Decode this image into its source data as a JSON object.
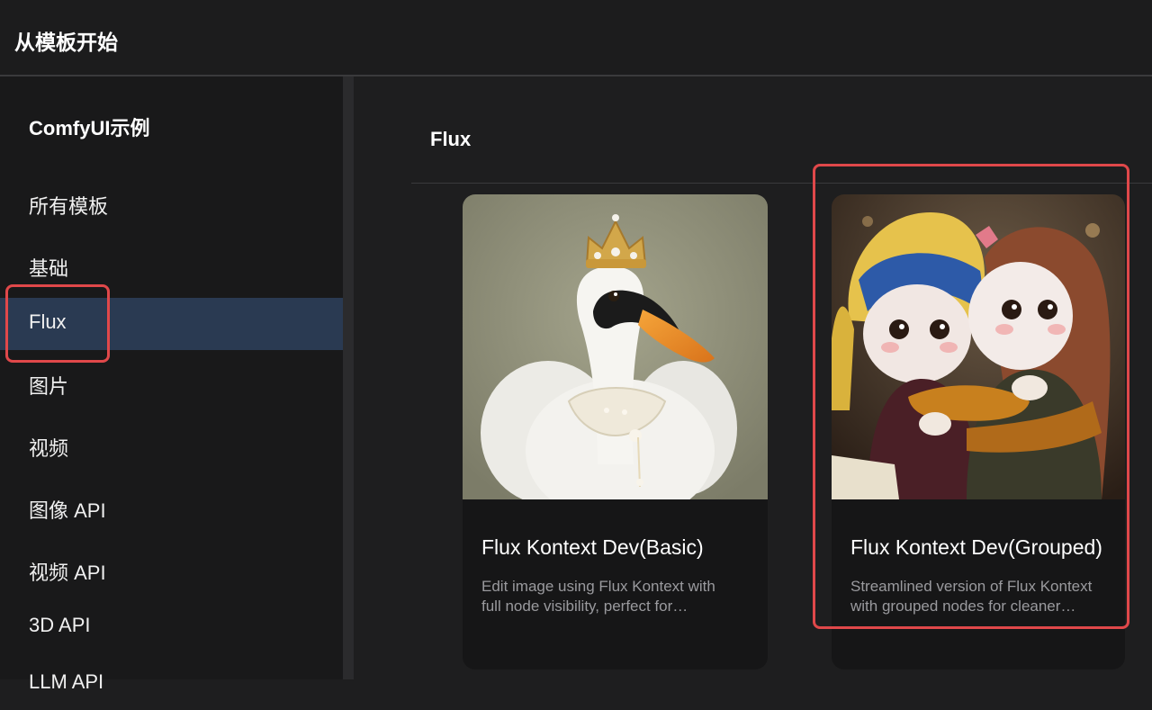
{
  "header": {
    "title": "从模板开始"
  },
  "sidebar": {
    "heading": "ComfyUI示例",
    "items": [
      {
        "label": "所有模板",
        "active": false
      },
      {
        "label": "基础",
        "active": false
      },
      {
        "label": "Flux",
        "active": true
      },
      {
        "label": "图片",
        "active": false
      },
      {
        "label": "视频",
        "active": false
      },
      {
        "label": "图像 API",
        "active": false
      },
      {
        "label": "视频 API",
        "active": false
      },
      {
        "label": "3D API",
        "active": false
      },
      {
        "label": "LLM API",
        "active": false
      }
    ]
  },
  "main": {
    "section_title": "Flux",
    "cards": [
      {
        "title": "Flux Kontext Dev(Basic)",
        "desc_line1": "Edit image using Flux Kontext with",
        "desc_line2": "full node visibility, perfect for…",
        "thumbnail": "swan-with-crown-image"
      },
      {
        "title": "Flux Kontext Dev(Grouped)",
        "desc_line1": "Streamlined version of Flux Kontext",
        "desc_line2": "with grouped nodes for cleaner…",
        "thumbnail": "knitted-dolls-hugging-image"
      }
    ]
  },
  "colors": {
    "active_item_bg": "#2a3a52",
    "highlight_border": "#e0484a",
    "muted_text": "#9a9a9e"
  }
}
